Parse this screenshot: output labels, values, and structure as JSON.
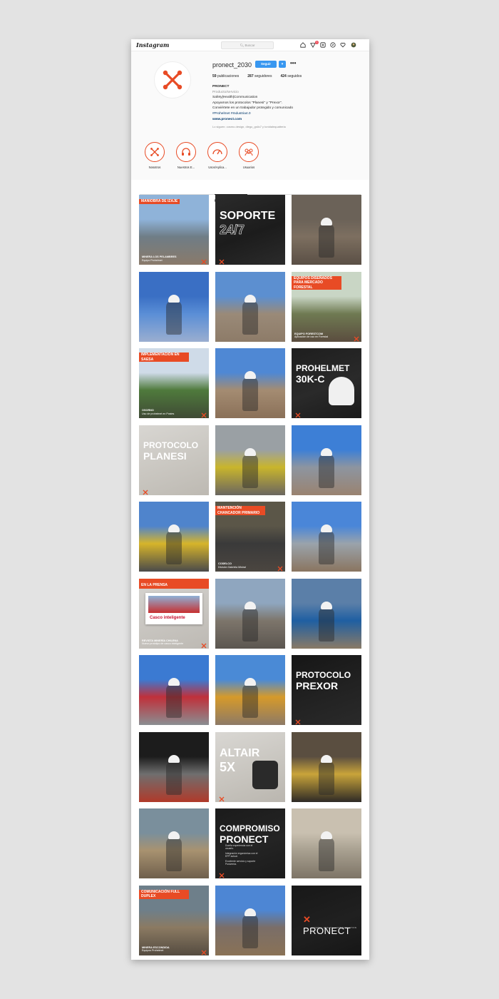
{
  "topbar": {
    "logo": "Instagram",
    "search_placeholder": "Buscar",
    "notification_count": "1",
    "icons": [
      "home-icon",
      "inbox-icon",
      "explore-icon",
      "compass-icon",
      "heart-icon",
      "profile-avatar"
    ]
  },
  "profile": {
    "username": "pronect_2030",
    "follow_label": "Seguir",
    "more_label": "•••",
    "stats": {
      "posts": "59",
      "posts_label": "publicaciones",
      "followers": "287",
      "followers_label": "seguidores",
      "following": "424",
      "following_label": "seguidos"
    },
    "bio": {
      "name": "PRONECT",
      "category": "Producto/servicio",
      "line1": "Safety|Health|Communication",
      "line2": "Apoyamos los protocolos \"Planesi\" y \"Prexor\".",
      "line3": "Conviértete en un trabajador protegido y comunicado",
      "tags": "#Prohelmet #Industria4.0",
      "link": "www.pronect.com",
      "followed_by": "Lo siguen: cosmo.design, diego_gsilo7 y tonidalequatteria"
    }
  },
  "highlights": [
    {
      "label": "Nosotros",
      "icon": "pronect-x-icon"
    },
    {
      "label": "Nuestros E...",
      "icon": "headset-icon"
    },
    {
      "label": "Usos/Aplica...",
      "icon": "gauge-icon"
    },
    {
      "label": "Usuarios",
      "icon": "users-icon"
    }
  ],
  "tabs": [
    {
      "label": "PUBLICACIONES",
      "active": true
    },
    {
      "label": "ETIQUETADAS",
      "active": false
    }
  ],
  "posts": [
    {
      "kind": "photo",
      "bg": [
        "#8fb3d9",
        "#6f7d86",
        "#8a7a6a"
      ],
      "tag": "MANIOBRA DE IZAJE",
      "caption_title": "MINERA LOS PELAMBRES",
      "caption_sub": "Equipo Prohelmet",
      "mark": true
    },
    {
      "kind": "dark",
      "bg": [
        "#2b2b2b",
        "#1c1c1c",
        "#2b2b2b"
      ],
      "title1": "SOPORTE",
      "title2": "24/7",
      "mark": true
    },
    {
      "kind": "photo",
      "bg": [
        "#6b6258",
        "#7d6f60",
        "#5a4f45"
      ],
      "accent": "orange-worker"
    },
    {
      "kind": "photo",
      "bg": [
        "#3a6fc4",
        "#5a8ed6",
        "#9aaed0"
      ],
      "accent": "crane"
    },
    {
      "kind": "photo",
      "bg": [
        "#5c8fd0",
        "#9a8a78",
        "#8d7b68"
      ],
      "accent": "workers"
    },
    {
      "kind": "photo",
      "bg": [
        "#c9d6c5",
        "#6f7a52",
        "#5b4d3f"
      ],
      "tag": "EQUIPOS DISEÑADOS PARA MERCADO FORESTAL",
      "caption_title": "EQUIPO FORESTCOM",
      "caption_sub": "Aplicación de uso en Forestal",
      "mark": true
    },
    {
      "kind": "photo",
      "bg": [
        "#cfdbe8",
        "#4f7a3c",
        "#3f4a35"
      ],
      "tag": "IMPLEMENTACIÓN EN SAESA",
      "caption_title": "OSORNO",
      "caption_sub": "Uso de prohelmet en Postes",
      "mark": true
    },
    {
      "kind": "photo",
      "bg": [
        "#4f88d4",
        "#a48c72",
        "#8a7058"
      ],
      "accent": "truck"
    },
    {
      "kind": "dark",
      "bg": [
        "#1e1e1e",
        "#2a2a2a",
        "#1a1a1a"
      ],
      "title1": "PROHELMET",
      "title2": "30K-C",
      "mark": true,
      "helmet": true
    },
    {
      "kind": "light",
      "bg": [
        "#d8d6d2",
        "#c9c6c0",
        "#bdb9b2"
      ],
      "title1": "PROTOCOLO",
      "title2": "PLANESI",
      "mark": true
    },
    {
      "kind": "photo",
      "bg": [
        "#9aa0a4",
        "#c9b52c",
        "#6a6660"
      ],
      "accent": "machine"
    },
    {
      "kind": "photo",
      "bg": [
        "#3d7fd6",
        "#8d95a0",
        "#9a8370"
      ],
      "accent": "loader"
    },
    {
      "kind": "photo",
      "bg": [
        "#4f84cc",
        "#d6b42a",
        "#4a4a4a"
      ],
      "accent": "driller"
    },
    {
      "kind": "photo",
      "bg": [
        "#5b5648",
        "#3a3a3a",
        "#4b4640"
      ],
      "tag": "MANTENCIÓN CHANCADOR PRIMARIO",
      "caption_title": "CODELCO",
      "caption_sub": "División Gabriela Mistral",
      "mark": true
    },
    {
      "kind": "photo",
      "bg": [
        "#4a86d8",
        "#9aa3ab",
        "#8a7560"
      ],
      "accent": "redtruck"
    },
    {
      "kind": "press",
      "bg": [
        "#d6d4d0",
        "#c8c5c0",
        "#bdb9b3"
      ],
      "tag": "EN LA PRENSA",
      "press_headline": "Casco inteligente",
      "caption_title": "REVISTA MINERÍA CHILENA",
      "caption_sub": "Nuevo prototipo de casco inteligente",
      "mark": true
    },
    {
      "kind": "photo",
      "bg": [
        "#8fa6bf",
        "#7d756b",
        "#5b5650"
      ],
      "accent": "helmetclose"
    },
    {
      "kind": "photo",
      "bg": [
        "#5b7fa8",
        "#1f5fa2",
        "#8a7a66"
      ],
      "accent": "container"
    },
    {
      "kind": "photo",
      "bg": [
        "#3b7ad2",
        "#c0303a",
        "#8a8e92"
      ],
      "accent": "cabin"
    },
    {
      "kind": "photo",
      "bg": [
        "#4a8ad6",
        "#d69a2a",
        "#8d7a66"
      ],
      "accent": "bigcrane"
    },
    {
      "kind": "dark",
      "bg": [
        "#161616",
        "#222",
        "#2a2a2a"
      ],
      "title1": "PROTOCOLO",
      "title2": "PREXOR",
      "mark": true
    },
    {
      "kind": "photo",
      "bg": [
        "#1c1c1c",
        "#6f6f6f",
        "#b03a2a"
      ],
      "accent": "operator"
    },
    {
      "kind": "light",
      "bg": [
        "#d9d7d3",
        "#c8c5bf",
        "#bab6af"
      ],
      "title1": "ALTAIR",
      "title2": "5X",
      "mark": true,
      "device": true
    },
    {
      "kind": "photo",
      "bg": [
        "#5a4e40",
        "#c9a43a",
        "#2e2a26"
      ],
      "accent": "nightworker"
    },
    {
      "kind": "photo",
      "bg": [
        "#7a8f9c",
        "#a89270",
        "#6f5f4c"
      ],
      "accent": "helmetback"
    },
    {
      "kind": "dark",
      "bg": [
        "#1b1b1b",
        "#242424",
        "#1b1b1b"
      ],
      "title1": "COMPROMISO",
      "title2": "PRONECT",
      "bullets": [
        "Dueña experiencia con el usuario.",
        "Integración ergonómica con el EPP actual.",
        "Excelente servicio y soporte Postventa."
      ],
      "mark": true
    },
    {
      "kind": "photo",
      "bg": [
        "#c9c0b0",
        "#a8a090",
        "#7d7466"
      ],
      "accent": "structure"
    },
    {
      "kind": "photo",
      "bg": [
        "#6e7f8a",
        "#8b7a62",
        "#544b40"
      ],
      "tag": "COMUNICACIÓN FULL DUPLEX",
      "caption_title": "MINERA ESCONDIDA",
      "caption_sub": "Equipos Prohelmet",
      "mark": true
    },
    {
      "kind": "photo",
      "bg": [
        "#4d86d4",
        "#7a6e68",
        "#8a7256"
      ],
      "accent": "volcano"
    },
    {
      "kind": "brand",
      "bg": [
        "#181818",
        "#202020",
        "#161616"
      ],
      "brand": "PRONECT",
      "brand_sub": "SAFETY | HEALTH | COMMUNICATION"
    }
  ],
  "colors": {
    "accent": "#e84b25",
    "link": "#00376b",
    "button": "#3897f0"
  }
}
